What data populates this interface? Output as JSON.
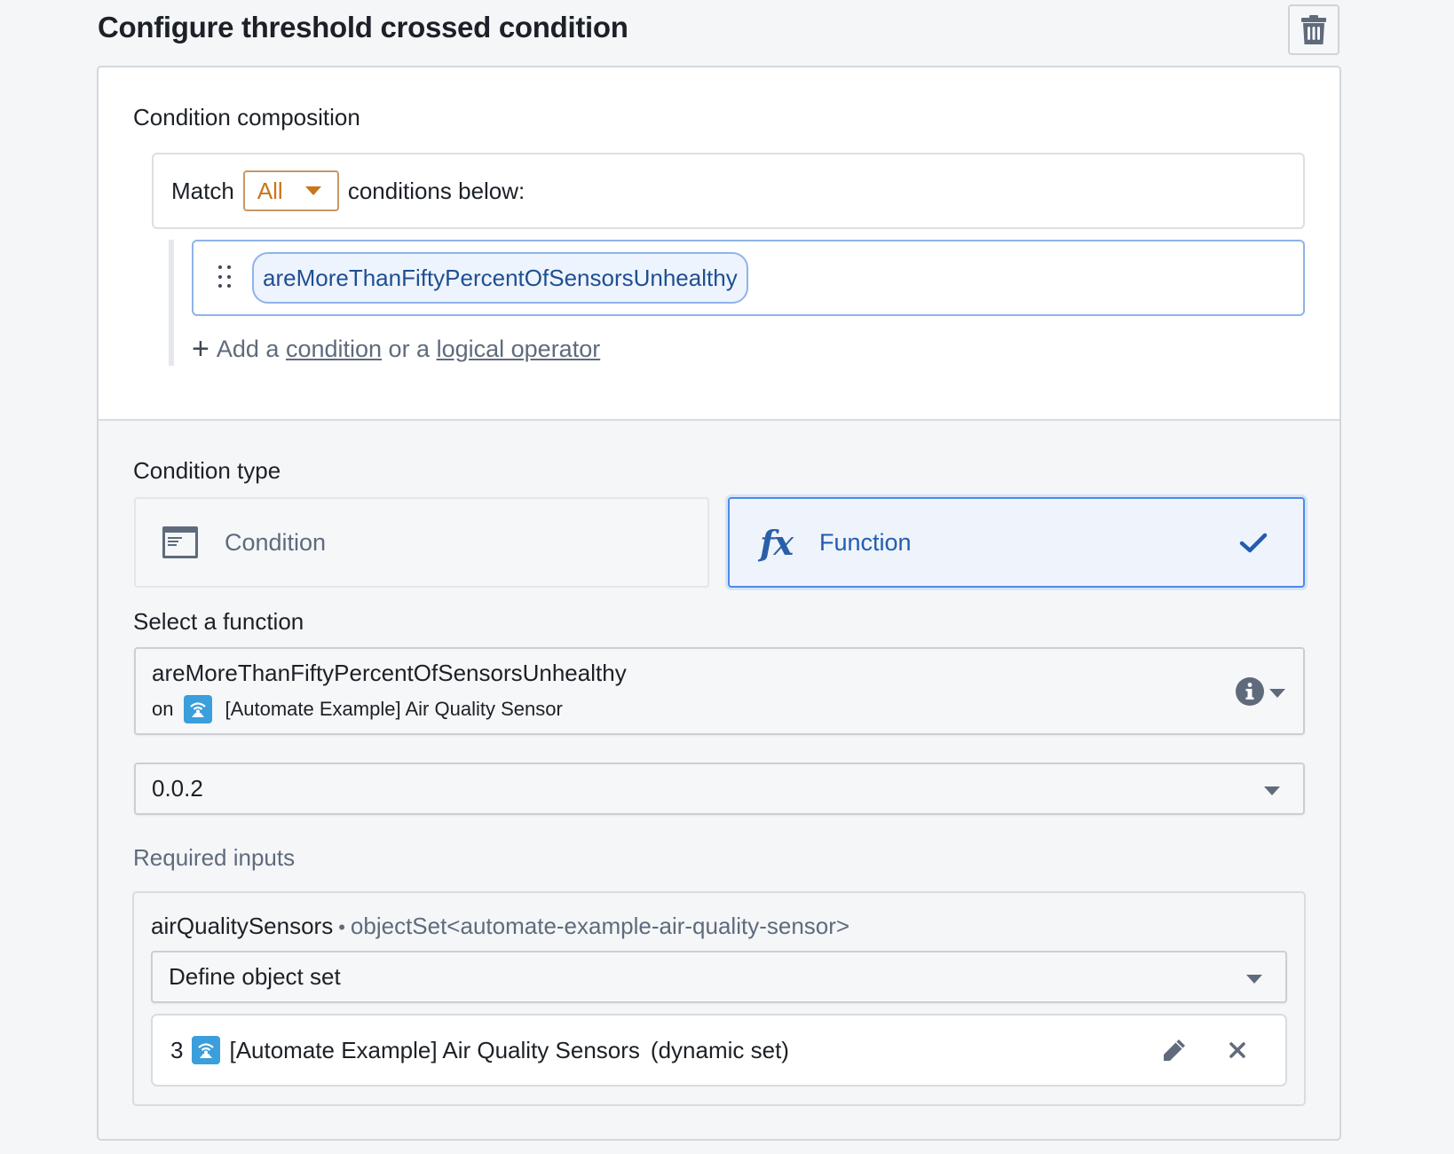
{
  "header": {
    "title": "Configure threshold crossed condition",
    "delete_icon": "trash-icon"
  },
  "composition": {
    "label": "Condition composition",
    "match_prefix": "Match",
    "match_value": "All",
    "match_suffix": "conditions below:",
    "conditions": [
      {
        "name": "areMoreThanFiftyPercentOfSensorsUnhealthy"
      }
    ],
    "add_prefix": "Add a",
    "add_condition_link": "condition",
    "add_middle": "or a",
    "add_operator_link": "logical operator"
  },
  "condition_type": {
    "label": "Condition type",
    "options": [
      {
        "label": "Condition",
        "icon": "form-icon",
        "selected": false
      },
      {
        "label": "Function",
        "icon": "function-icon",
        "selected": true
      }
    ]
  },
  "function_select": {
    "label": "Select a function",
    "function_name": "areMoreThanFiftyPercentOfSensorsUnhealthy",
    "on_label": "on",
    "object_type": "[Automate Example] Air Quality Sensor",
    "version": "0.0.2"
  },
  "required_inputs": {
    "label": "Required inputs",
    "inputs": [
      {
        "name": "airQualitySensors",
        "separator": "•",
        "type": "objectSet<automate-example-air-quality-sensor>",
        "mode": "Define object set",
        "object_set": {
          "count": "3",
          "name": "[Automate Example] Air Quality Sensors",
          "kind": "(dynamic set)"
        }
      }
    ]
  },
  "colors": {
    "accent_blue": "#4a8bea",
    "chip_text": "#1f4f91",
    "match_orange": "#c87619",
    "sensor_icon": "#3a9fdb"
  }
}
